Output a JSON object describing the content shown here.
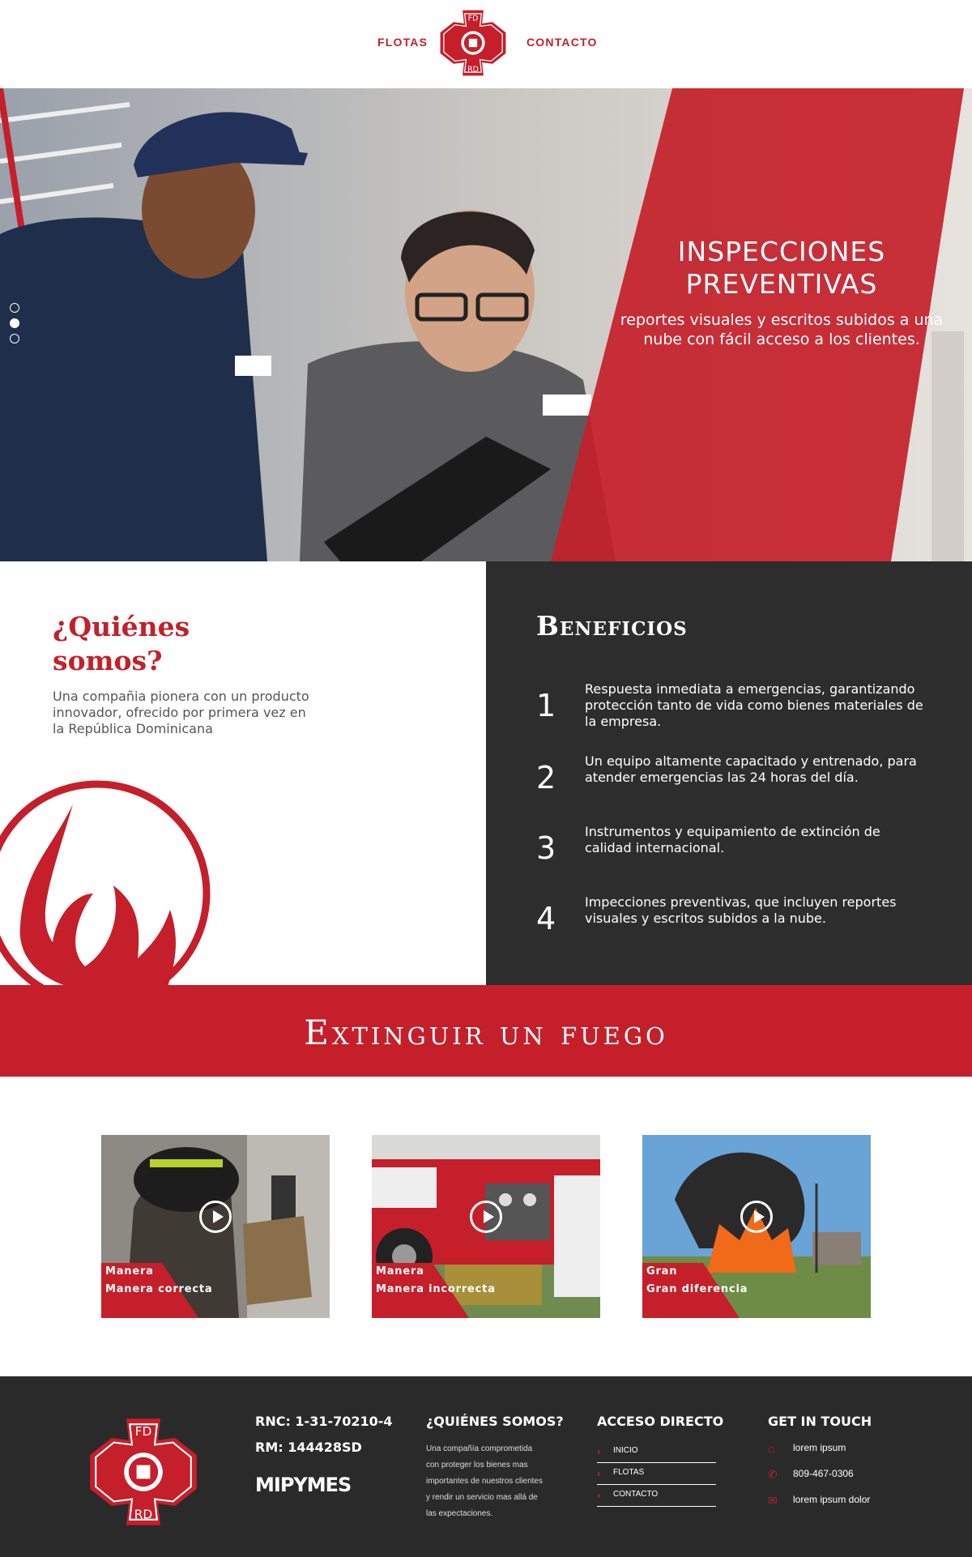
{
  "header": {
    "nav_left": "FLOTAS",
    "nav_right": "CONTACTO",
    "logo_top": "FD",
    "logo_bottom": "RD"
  },
  "hero": {
    "title_line1": "INSPECCIONES",
    "title_line2": "PREVENTIVAS",
    "subtitle": "reportes visuales y escritos subidos a una nube con fácil acceso a los clientes.",
    "slides": 3,
    "active_slide": 2
  },
  "about": {
    "title_line1": "¿Quiénes",
    "title_line2": "somos?",
    "text": "Una compañia pionera con un producto innovador, ofrecido por primera vez en la República Dominicana"
  },
  "benefits": {
    "title": "Beneficios",
    "items": [
      {
        "num": "1",
        "text": "Respuesta inmediata a emergencias, garantizando protección tanto de vida como bienes materiales de la empresa."
      },
      {
        "num": "2",
        "text": "Un equipo altamente capacitado y entrenado, para atender emergencias las 24 horas del día."
      },
      {
        "num": "3",
        "text": "Instrumentos y equipamiento de extinción de calidad internacional."
      },
      {
        "num": "4",
        "text": "Impecciones preventivas, que incluyen reportes visuales y escritos subidos a la nube."
      }
    ]
  },
  "banner": {
    "text": "Extinguir un fuego"
  },
  "videos": [
    {
      "label1": "Manera",
      "label2": "Manera correcta"
    },
    {
      "label1": "Manera",
      "label2": "Manera incorrecta"
    },
    {
      "label1": "Gran",
      "label2": "Gran diferencia"
    }
  ],
  "footer": {
    "rnc": "RNC: 1-31-70210-4",
    "rm": "RM: 144428SD",
    "mipymes": "MIPYMES",
    "about_title": "¿QUIÉNES SOMOS?",
    "about_text": "Una compañía comprometida con proteger los bienes mas importantes de nuestros clientes y rendir un servicio mas allá de las expectaciones.",
    "acceso_title": "ACCESO DIRECTO",
    "links": [
      "INICIO",
      "FLOTAS",
      "CONTACTO"
    ],
    "touch_title": "GET IN TOUCH",
    "address": "lorem ipsum",
    "phone": "809-467-0306",
    "email": "lorem ipsum dolor",
    "icons": [
      "home-icon",
      "phone-icon",
      "mail-icon"
    ]
  },
  "colors": {
    "brand_red": "#c41f2a",
    "dark": "#2d2d2d",
    "footer": "#2a2a2a"
  }
}
